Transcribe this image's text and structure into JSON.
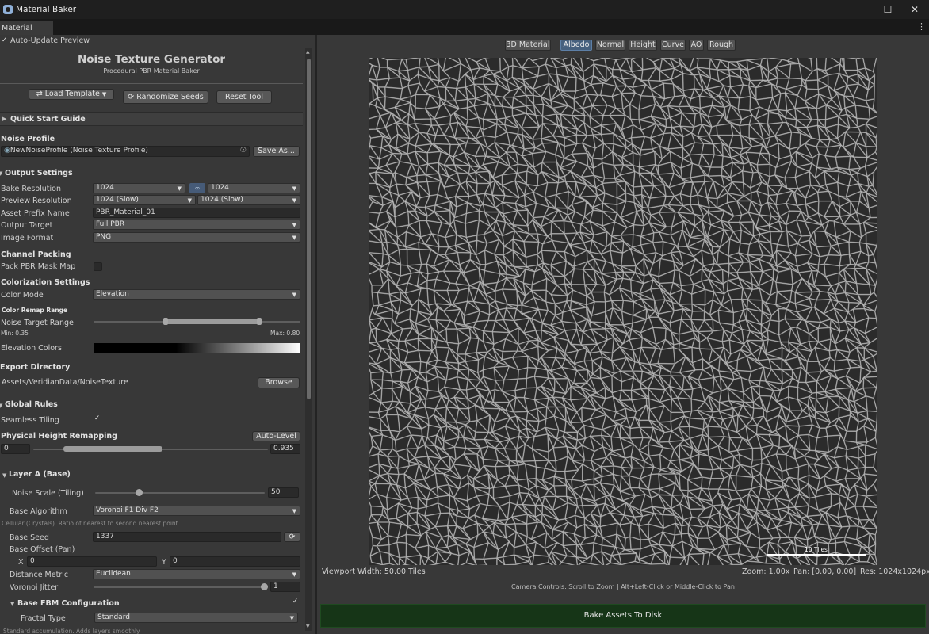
{
  "window": {
    "title": "Material Baker",
    "tab": "Material Baker",
    "minimize_icon": "minimize-icon",
    "maximize_icon": "maximize-icon",
    "close_icon": "close-icon"
  },
  "auto_update": {
    "label": "Auto-Update Preview",
    "checked": true
  },
  "header": {
    "title": "Noise Texture Generator",
    "subtitle": "Procedural PBR Material Baker"
  },
  "toolbar": {
    "load_template": "Load Template",
    "randomize": "Randomize Seeds",
    "reset": "Reset Tool"
  },
  "quick_start": {
    "label": "Quick Start Guide"
  },
  "noise_profile": {
    "header": "Noise Profile",
    "value": "NewNoiseProfile (Noise Texture Profile)",
    "save_as": "Save As..."
  },
  "output": {
    "header": "Output Settings",
    "bake_res_label": "Bake Resolution",
    "bake_res_a": "1024",
    "bake_res_b": "1024",
    "prev_res_label": "Preview Resolution",
    "prev_res_a": "1024 (Slow)",
    "prev_res_b": "1024 (Slow)",
    "prefix_label": "Asset Prefix Name",
    "prefix_value": "PBR_Material_01",
    "target_label": "Output Target",
    "target_value": "Full PBR",
    "format_label": "Image Format",
    "format_value": "PNG"
  },
  "channel_packing": {
    "header": "Channel Packing",
    "pack_label": "Pack PBR Mask Map",
    "pack_checked": false
  },
  "colorization": {
    "header": "Colorization Settings",
    "mode_label": "Color Mode",
    "mode_value": "Elevation",
    "remap_header": "Color Remap Range",
    "range_label": "Noise Target Range",
    "min_text": "Min: 0.35",
    "max_text": "Max: 0.80",
    "range_min": 0.35,
    "range_max": 0.8,
    "elevation_label": "Elevation Colors"
  },
  "export": {
    "header": "Export Directory",
    "path": "Assets/VeridianData/NoiseTexture",
    "browse": "Browse"
  },
  "global_rules": {
    "header": "Global Rules",
    "seamless_label": "Seamless Tiling",
    "seamless_checked": true,
    "height_label": "Physical Height Remapping",
    "auto_level": "Auto-Level",
    "height_min": "0",
    "height_max": "0.935"
  },
  "layer_a": {
    "header": "Layer A (Base)",
    "scale_label": "Noise Scale (Tiling)",
    "scale_value": "50",
    "algo_label": "Base Algorithm",
    "algo_value": "Voronoi F1 Div F2",
    "algo_desc": "Cellular (Crystals). Ratio of nearest to second nearest point.",
    "seed_label": "Base Seed",
    "seed_value": "1337",
    "offset_label": "Base Offset (Pan)",
    "offset_x_label": "X",
    "offset_x": "0",
    "offset_y_label": "Y",
    "offset_y": "0",
    "metric_label": "Distance Metric",
    "metric_value": "Euclidean",
    "jitter_label": "Voronoi Jitter",
    "jitter_value": "1",
    "fbm_header": "Base FBM Configuration",
    "fbm_checked": true,
    "fractal_label": "Fractal Type",
    "fractal_value": "Standard",
    "fractal_desc": "Standard accumulation. Adds layers smoothly."
  },
  "viewport": {
    "modes": [
      "3D Material",
      "Albedo",
      "Normal",
      "Height",
      "Curve",
      "AO",
      "Rough"
    ],
    "active_mode": "Albedo",
    "scale_label": "10 Tiles",
    "width_text": "Viewport Width: 50.00 Tiles",
    "zoom_text": "Zoom: 1.00x",
    "pan_text": "Pan: [0.00, 0.00]",
    "res_text": "Res: 1024x1024px",
    "camera_hint": "Camera Controls: Scroll to Zoom  |  Alt+Left-Click or Middle-Click to Pan",
    "bake_label": "Bake Assets To Disk"
  },
  "colors": {
    "accent": "#46607e",
    "bake": "#163517",
    "panel": "#383838",
    "field": "#2a2a2a"
  }
}
